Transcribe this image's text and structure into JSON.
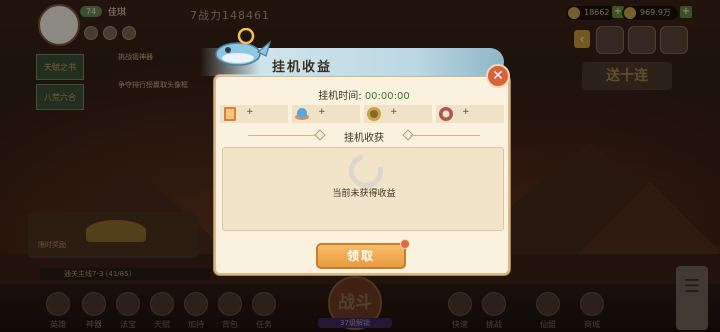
{
  "hud": {
    "player_name": "佳琪",
    "level": "74",
    "power": "7战力148461",
    "resource_1": "18662",
    "resource_2": "969.9万",
    "promo": "送十连"
  },
  "left_tasks": {
    "task_1": "挑战锻神器",
    "task_2": "争夺排行榜赢取头像框",
    "panel_1": "天赋之书",
    "panel_2": "八荒六合"
  },
  "scene": {
    "timer_label": "限时奖励",
    "stage_label": "通关主线7-3",
    "stage_progress": "(41/85)",
    "battle_label": "战斗",
    "battle_sub": "37级解锁"
  },
  "bottom_nav": [
    {
      "label": "英雄"
    },
    {
      "label": "神器"
    },
    {
      "label": "法宝"
    },
    {
      "label": "天赋"
    },
    {
      "label": "加持"
    },
    {
      "label": "背包"
    },
    {
      "label": "任务"
    },
    {
      "label": "快速"
    },
    {
      "label": "挑战"
    },
    {
      "label": "仙盟"
    },
    {
      "label": "商城"
    }
  ],
  "modal": {
    "title": "挂机收益",
    "idle_time_label": "挂机时间:",
    "idle_time_value": "00:00:00",
    "rewards": [
      {
        "icon": "book-icon",
        "amount": "+"
      },
      {
        "icon": "crystal-icon",
        "amount": "+"
      },
      {
        "icon": "coin-icon",
        "amount": "+"
      },
      {
        "icon": "orb-icon",
        "amount": "+"
      }
    ],
    "section_title": "挂机收获",
    "empty_text": "当前未获得收益",
    "claim_label": "领取",
    "colors": {
      "accent": "#e89a3e",
      "time": "#3f7a32",
      "close": "#d8623a"
    }
  }
}
